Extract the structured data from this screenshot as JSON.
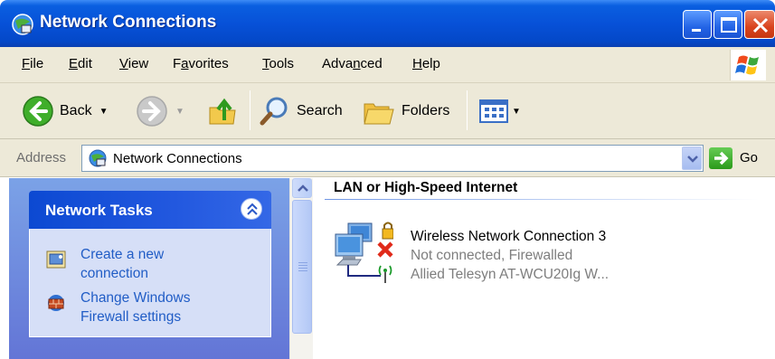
{
  "window": {
    "title": "Network Connections"
  },
  "menu": {
    "items": [
      {
        "label": "File",
        "accel": "F"
      },
      {
        "label": "Edit",
        "accel": "E"
      },
      {
        "label": "View",
        "accel": "V"
      },
      {
        "label": "Favorites",
        "accel": "a"
      },
      {
        "label": "Tools",
        "accel": "T"
      },
      {
        "label": "Advanced",
        "accel": "n"
      },
      {
        "label": "Help",
        "accel": "H"
      }
    ]
  },
  "toolbar": {
    "back_label": "Back",
    "search_label": "Search",
    "folders_label": "Folders"
  },
  "address": {
    "label": "Address",
    "value": "Network Connections",
    "go_label": "Go"
  },
  "tasks": {
    "title": "Network Tasks",
    "links": [
      {
        "line1": "Create a new",
        "line2": "connection"
      },
      {
        "line1": "Change Windows",
        "line2": "Firewall settings"
      }
    ]
  },
  "content": {
    "group_title": "LAN or High-Speed Internet",
    "connection": {
      "name": "Wireless Network Connection 3",
      "status": "Not connected, Firewalled",
      "device": "Allied Telesyn AT-WCU20Ig W..."
    }
  },
  "colors": {
    "titlebar_blue": "#0751d8",
    "chrome_beige": "#ede9d8",
    "taskpane_blue": "#6375d6",
    "link_blue": "#215dc6",
    "close_red": "#d9431d"
  },
  "icons": {
    "title": "network-globe-icon",
    "back": "back-arrow-icon",
    "forward": "forward-arrow-icon",
    "up": "up-folder-icon",
    "search": "magnifier-icon",
    "folders": "folders-icon",
    "views": "views-grid-icon",
    "go": "go-arrow-icon",
    "collapse": "double-chevron-up-icon",
    "create": "new-connection-icon",
    "firewall": "firewall-brick-icon",
    "connection": "wireless-connection-icon"
  }
}
